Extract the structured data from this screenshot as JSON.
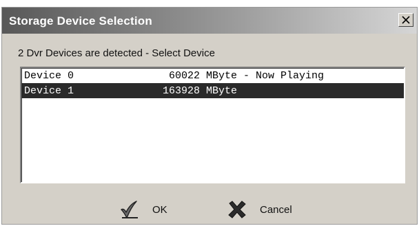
{
  "window": {
    "title": "Storage Device Selection",
    "close_glyph": "X"
  },
  "prompt": "2 Dvr Devices are detected - Select Device",
  "devices": [
    {
      "name": "Device 0",
      "size": "60022",
      "unit_status": "MByte - Now Playing",
      "selected": false
    },
    {
      "name": "Device 1",
      "size": "163928",
      "unit_status": "MByte",
      "selected": true
    }
  ],
  "buttons": {
    "ok_label": "OK",
    "ok_icon": "checkmark-icon",
    "cancel_label": "Cancel",
    "cancel_icon": "x-cancel-icon"
  },
  "colors": {
    "selection_bg": "#2a2a2a",
    "dialog_bg": "#d4d0c8"
  }
}
